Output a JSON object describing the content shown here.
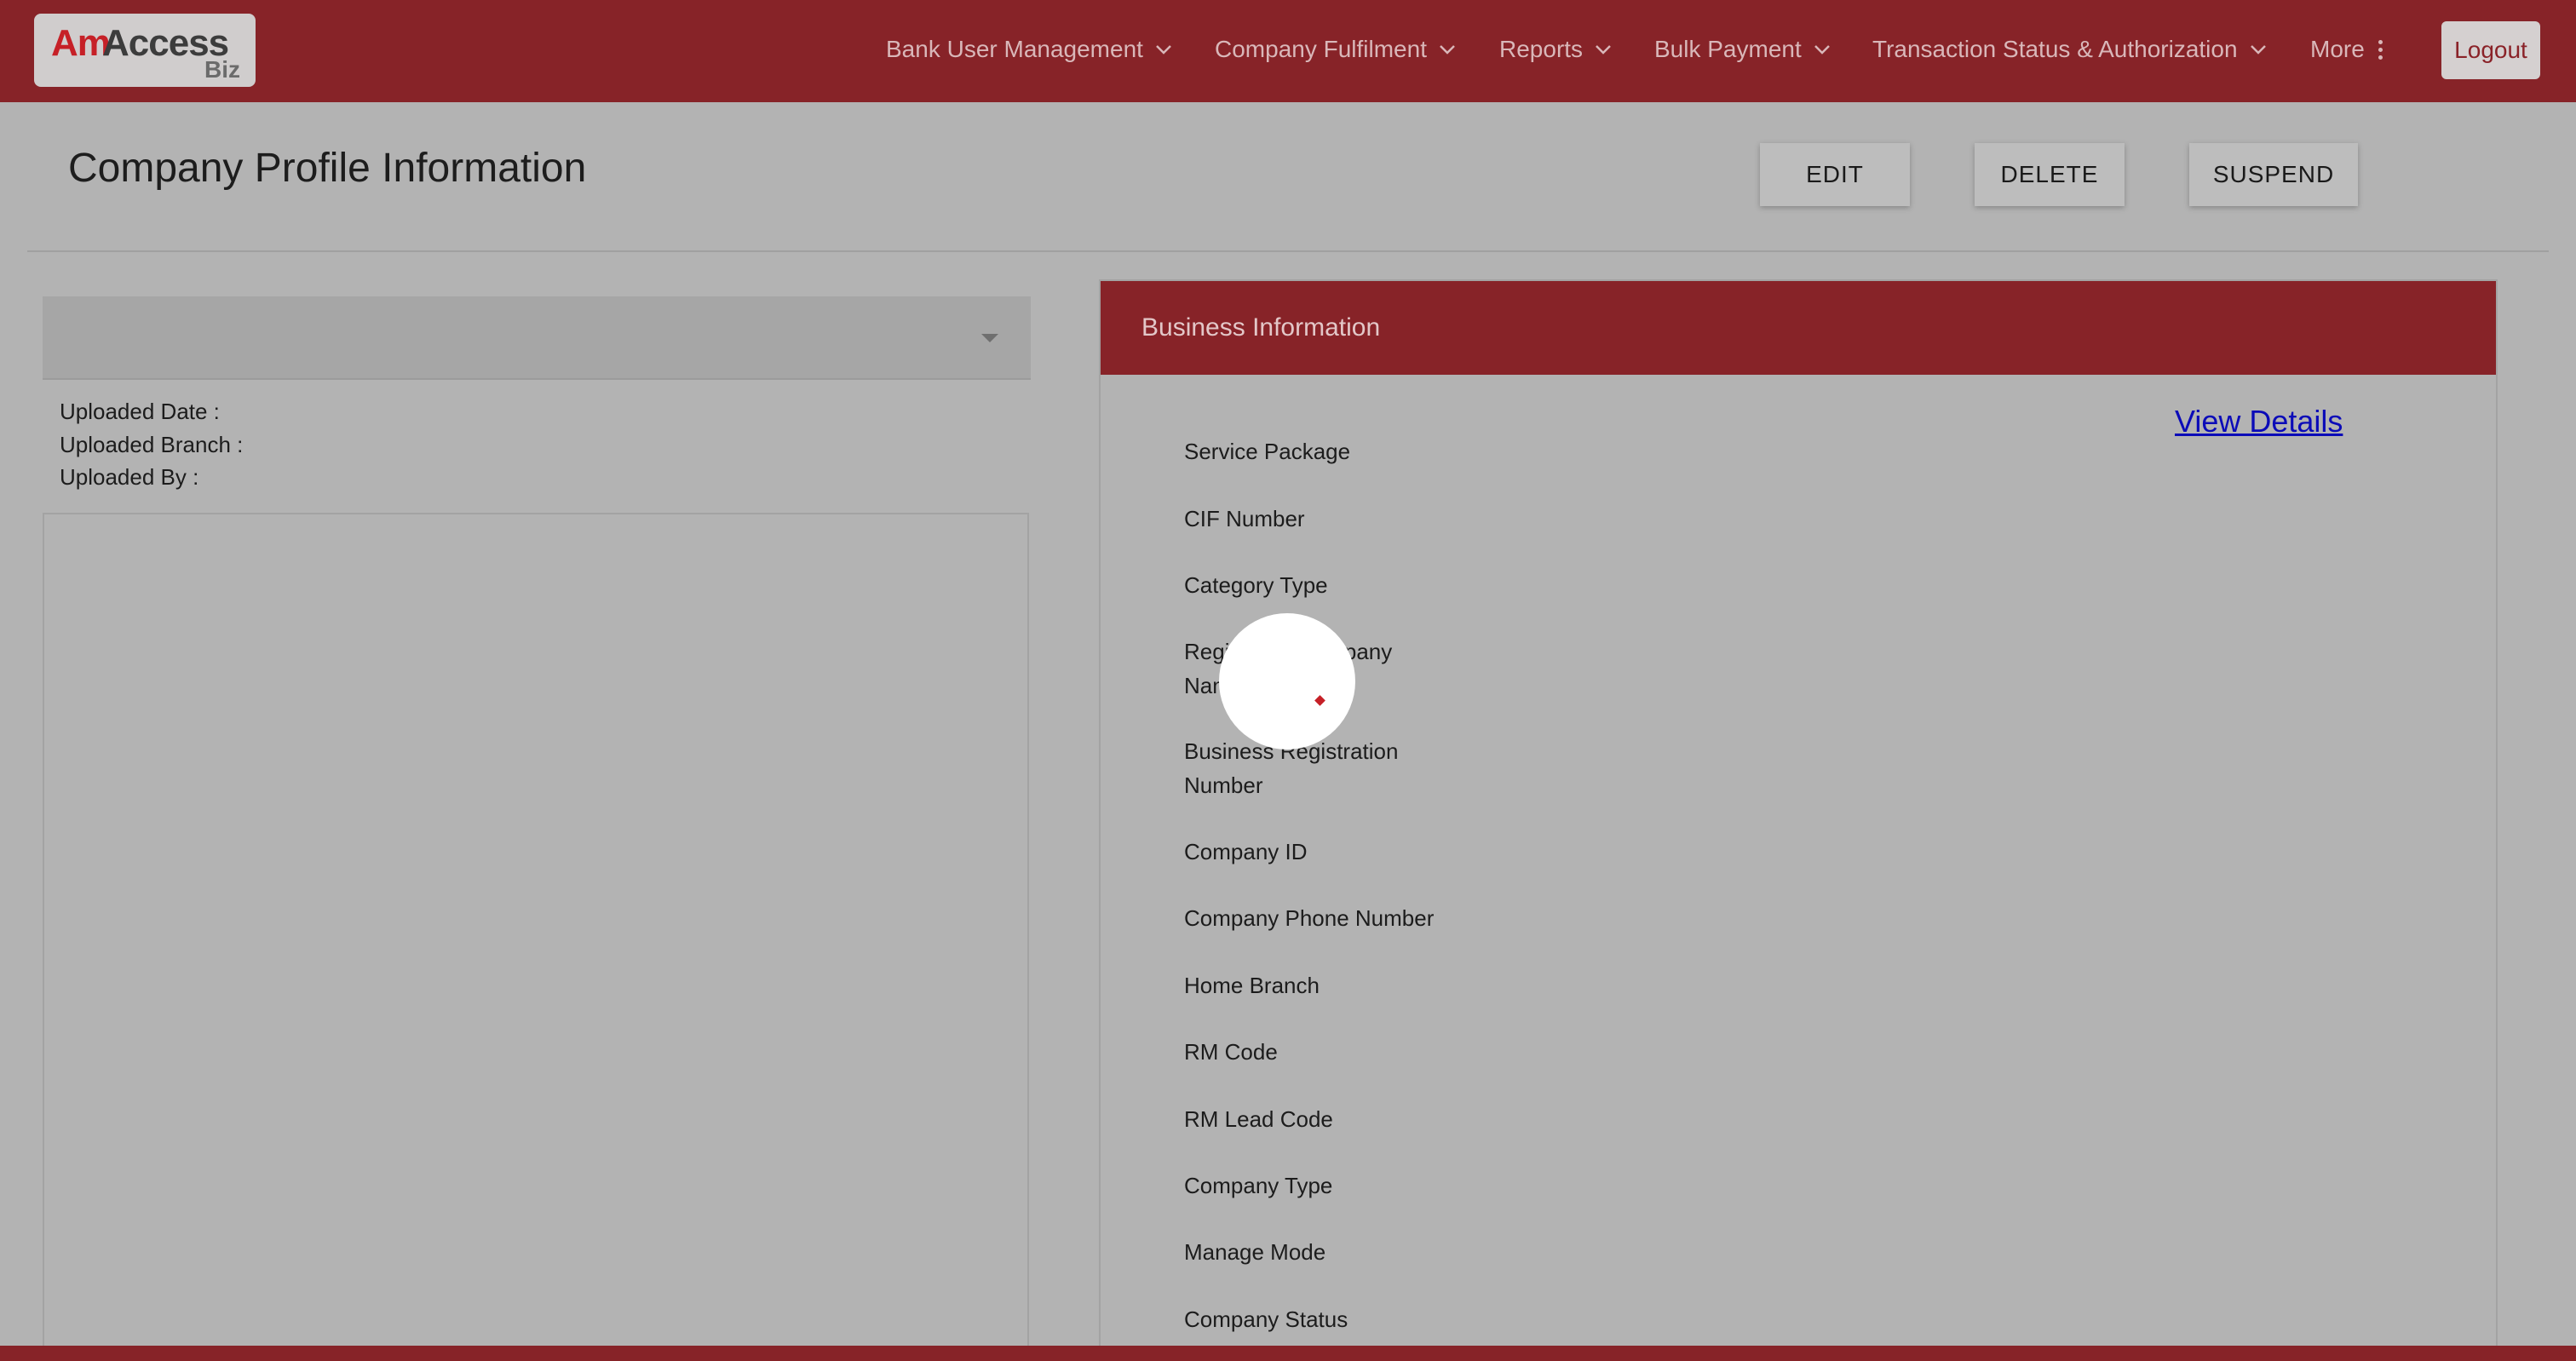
{
  "logo": {
    "am": "Am",
    "access": "Access",
    "biz": "Biz"
  },
  "nav": {
    "items": [
      {
        "label": "Bank User Management"
      },
      {
        "label": "Company Fulfilment"
      },
      {
        "label": "Reports"
      },
      {
        "label": "Bulk Payment"
      },
      {
        "label": "Transaction Status & Authorization"
      },
      {
        "label": "More"
      }
    ],
    "logout": "Logout"
  },
  "page": {
    "title": "Company Profile Information"
  },
  "actions": {
    "edit": "EDIT",
    "delete": "DELETE",
    "suspend": "SUSPEND"
  },
  "documents": {
    "selected": "",
    "uploaded_date_label": "Uploaded Date :",
    "uploaded_branch_label": "Uploaded Branch :",
    "uploaded_by_label": "Uploaded By :"
  },
  "business": {
    "header": "Business Information",
    "view_details": "View Details",
    "fields": [
      "Service Package",
      "CIF Number",
      "Category Type",
      "Registered Company Name",
      "Business Registration Number",
      "Company ID",
      "Company Phone Number",
      "Home Branch",
      "RM Code",
      "RM Lead Code",
      "Company Type",
      "Manage Mode",
      "Company Status"
    ]
  },
  "colors": {
    "brand": "#872328",
    "brand_red": "#c62027",
    "overlay_bg": "#b3b3b3",
    "link": "#0b0bb8"
  }
}
